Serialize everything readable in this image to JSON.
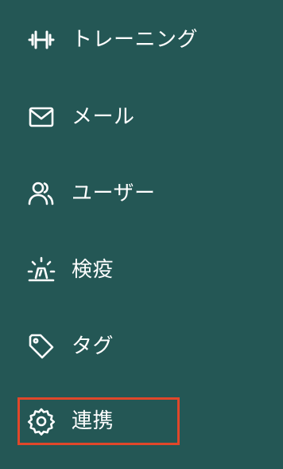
{
  "sidebar": {
    "items": [
      {
        "label": "トレーニング",
        "icon": "dumbbell-icon",
        "active": false
      },
      {
        "label": "メール",
        "icon": "mail-icon",
        "active": false
      },
      {
        "label": "ユーザー",
        "icon": "users-icon",
        "active": false
      },
      {
        "label": "検疫",
        "icon": "siren-icon",
        "active": false
      },
      {
        "label": "タグ",
        "icon": "tag-icon",
        "active": false
      },
      {
        "label": "連携",
        "icon": "gear-icon",
        "active": true
      }
    ]
  },
  "colors": {
    "background": "#245755",
    "text": "#ffffff",
    "highlight_border": "#e0472a"
  }
}
